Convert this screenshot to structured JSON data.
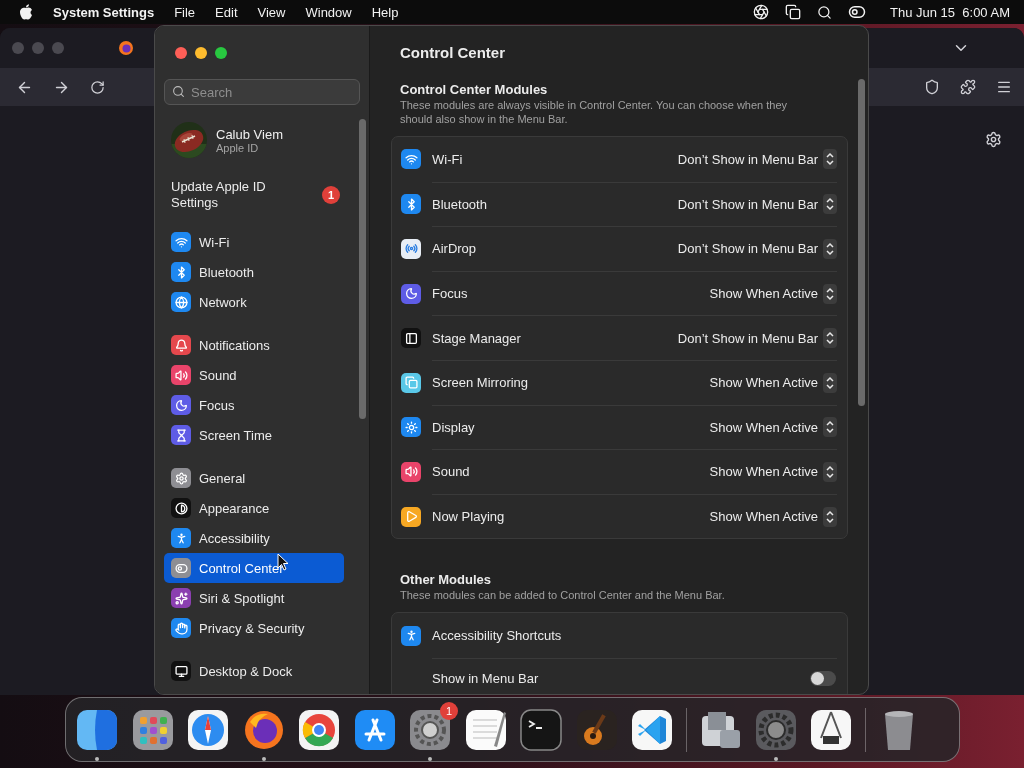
{
  "menu_bar": {
    "app_name": "System Settings",
    "menus": [
      "File",
      "Edit",
      "View",
      "Window",
      "Help"
    ],
    "clock": "Thu Jun 15  6:00 AM"
  },
  "sidebar": {
    "search": {
      "placeholder": "Search"
    },
    "account": {
      "name": "Calub Viem",
      "subtitle": "Apple ID"
    },
    "notice": {
      "label": "Update Apple ID Settings",
      "badge": "1"
    },
    "groups": [
      {
        "items": [
          {
            "label": "Wi-Fi",
            "color": "#1e88f0",
            "selected": false
          },
          {
            "label": "Bluetooth",
            "color": "#1e88f0",
            "selected": false
          },
          {
            "label": "Network",
            "color": "#1e88f0",
            "selected": false
          }
        ]
      },
      {
        "items": [
          {
            "label": "Notifications",
            "color": "#e5484d",
            "selected": false
          },
          {
            "label": "Sound",
            "color": "#e9446a",
            "selected": false
          },
          {
            "label": "Focus",
            "color": "#5e5ce6",
            "selected": false
          },
          {
            "label": "Screen Time",
            "color": "#5e5ce6",
            "selected": false
          }
        ]
      },
      {
        "items": [
          {
            "label": "General",
            "color": "#8e8e93",
            "selected": false
          },
          {
            "label": "Appearance",
            "color": "#111111",
            "selected": false
          },
          {
            "label": "Accessibility",
            "color": "#1e88f0",
            "selected": false
          },
          {
            "label": "Control Center",
            "color": "#8e8e93",
            "selected": true
          },
          {
            "label": "Siri & Spotlight",
            "color": "#8b3fb0",
            "selected": false
          },
          {
            "label": "Privacy & Security",
            "color": "#1e88f0",
            "selected": false
          }
        ]
      },
      {
        "items": [
          {
            "label": "Desktop & Dock",
            "color": "#111111",
            "selected": false
          }
        ]
      }
    ]
  },
  "content": {
    "title": "Control Center",
    "sections": [
      {
        "heading": "Control Center Modules",
        "description": "These modules are always visible in Control Center. You can choose when they should also show in the Menu Bar.",
        "rows": [
          {
            "label": "Wi-Fi",
            "color": "#1e88f0",
            "value": "Don’t Show in Menu Bar"
          },
          {
            "label": "Bluetooth",
            "color": "#1e88f0",
            "value": "Don’t Show in Menu Bar"
          },
          {
            "label": "AirDrop",
            "color": "#e8eef6",
            "value": "Don’t Show in Menu Bar"
          },
          {
            "label": "Focus",
            "color": "#5e5ce6",
            "value": "Show When Active"
          },
          {
            "label": "Stage Manager",
            "color": "#111111",
            "value": "Don’t Show in Menu Bar"
          },
          {
            "label": "Screen Mirroring",
            "color": "#5ac8e8",
            "value": "Show When Active"
          },
          {
            "label": "Display",
            "color": "#1e88f0",
            "value": "Show When Active"
          },
          {
            "label": "Sound",
            "color": "#e9446a",
            "value": "Show When Active"
          },
          {
            "label": "Now Playing",
            "color": "#f7a823",
            "value": "Show When Active"
          }
        ]
      },
      {
        "heading": "Other Modules",
        "description": "These modules can be added to Control Center and the Menu Bar.",
        "rows": [
          {
            "label": "Accessibility Shortcuts",
            "color": "#1e88f0",
            "children": [
              {
                "label": "Show in Menu Bar",
                "on": false
              }
            ]
          }
        ]
      }
    ]
  },
  "dock": {
    "items": [
      {
        "kind": "app",
        "running": true
      },
      {
        "kind": "app",
        "running": false
      },
      {
        "kind": "app",
        "running": false
      },
      {
        "kind": "app",
        "running": true
      },
      {
        "kind": "app",
        "running": false
      },
      {
        "kind": "app",
        "running": false
      },
      {
        "kind": "app",
        "running": true,
        "badge": "1"
      },
      {
        "kind": "app",
        "running": false
      },
      {
        "kind": "app",
        "running": false
      },
      {
        "kind": "app",
        "running": false
      },
      {
        "kind": "app",
        "running": false
      },
      {
        "kind": "separator"
      },
      {
        "kind": "app",
        "running": false
      },
      {
        "kind": "app",
        "running": true
      },
      {
        "kind": "app",
        "running": false
      },
      {
        "kind": "separator"
      },
      {
        "kind": "app",
        "running": false
      }
    ]
  }
}
